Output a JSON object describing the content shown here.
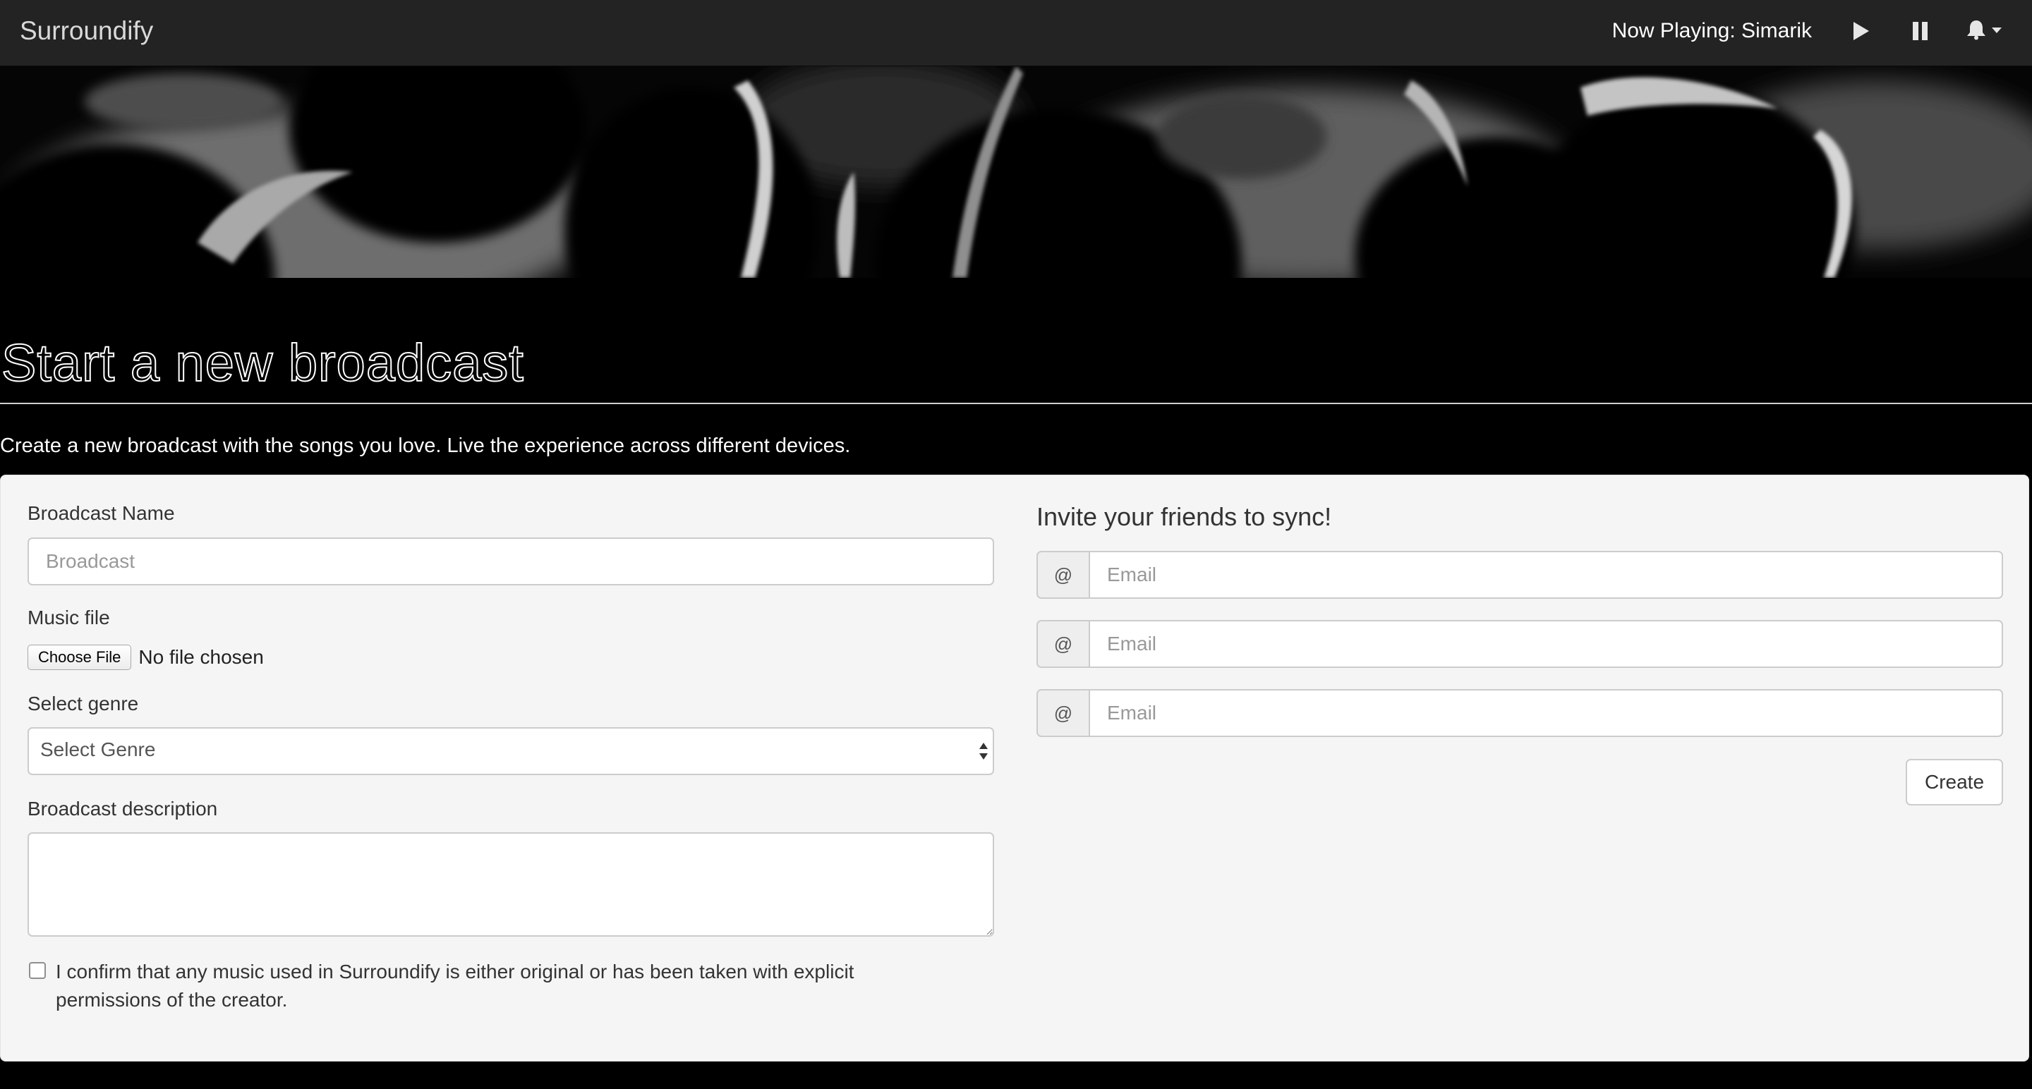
{
  "navbar": {
    "brand": "Surroundify",
    "now_playing": "Now Playing: Simarik",
    "icons": [
      "play-icon",
      "pause-icon",
      "bell-icon",
      "caret-down-icon"
    ]
  },
  "hero": {
    "image": "crowd-photo-grayscale"
  },
  "header": {
    "title": "Start a new broadcast",
    "lead": "Create a new broadcast with the songs you love. Live the experience across different devices."
  },
  "form": {
    "name_label": "Broadcast Name",
    "name_placeholder": "Broadcast",
    "file_label": "Music file",
    "file_button": "Choose File",
    "file_status": "No file chosen",
    "genre_label": "Select genre",
    "genre_selected": "Select Genre",
    "description_label": "Broadcast description",
    "description_value": "",
    "confirm_text": "I confirm that any music used in Surroundify is either original or has been taken with explicit permissions of the creator."
  },
  "invite": {
    "title": "Invite your friends to sync!",
    "addon": "@",
    "email_placeholder": "Email",
    "create_label": "Create"
  },
  "colors": {
    "navbar_bg": "#232323",
    "page_bg": "#000000",
    "panel_bg": "#f5f5f5",
    "border": "#cccccc"
  }
}
